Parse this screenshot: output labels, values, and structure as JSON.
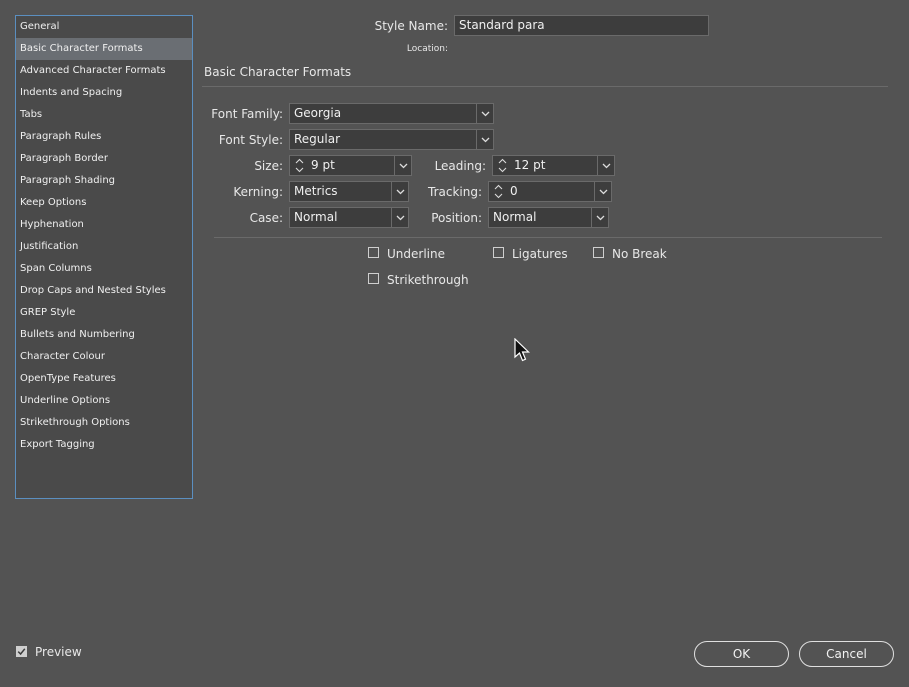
{
  "sidebar": {
    "items": [
      {
        "label": "General"
      },
      {
        "label": "Basic Character Formats"
      },
      {
        "label": "Advanced Character Formats"
      },
      {
        "label": "Indents and Spacing"
      },
      {
        "label": "Tabs"
      },
      {
        "label": "Paragraph Rules"
      },
      {
        "label": "Paragraph Border"
      },
      {
        "label": "Paragraph Shading"
      },
      {
        "label": "Keep Options"
      },
      {
        "label": "Hyphenation"
      },
      {
        "label": "Justification"
      },
      {
        "label": "Span Columns"
      },
      {
        "label": "Drop Caps and Nested Styles"
      },
      {
        "label": "GREP Style"
      },
      {
        "label": "Bullets and Numbering"
      },
      {
        "label": "Character Colour"
      },
      {
        "label": "OpenType Features"
      },
      {
        "label": "Underline Options"
      },
      {
        "label": "Strikethrough Options"
      },
      {
        "label": "Export Tagging"
      }
    ],
    "selected_index": 1
  },
  "header": {
    "style_name_label": "Style Name:",
    "style_name_value": "Standard para",
    "location_label": "Location:"
  },
  "section_title": "Basic Character Formats",
  "form": {
    "font_family": {
      "label": "Font Family:",
      "value": "Georgia"
    },
    "font_style": {
      "label": "Font Style:",
      "value": "Regular"
    },
    "size": {
      "label": "Size:",
      "value": "9 pt"
    },
    "leading": {
      "label": "Leading:",
      "value": "12 pt"
    },
    "kerning": {
      "label": "Kerning:",
      "value": "Metrics"
    },
    "tracking": {
      "label": "Tracking:",
      "value": "0"
    },
    "case": {
      "label": "Case:",
      "value": "Normal"
    },
    "position": {
      "label": "Position:",
      "value": "Normal"
    }
  },
  "checkboxes": {
    "underline": {
      "label": "Underline",
      "checked": false
    },
    "ligatures": {
      "label": "Ligatures",
      "checked": false
    },
    "no_break": {
      "label": "No Break",
      "checked": false
    },
    "strikethrough": {
      "label": "Strikethrough",
      "checked": false
    }
  },
  "footer": {
    "preview_label": "Preview",
    "preview_checked": true,
    "ok_label": "OK",
    "cancel_label": "Cancel"
  },
  "colors": {
    "background": "#535353",
    "sidebar_border": "#5b8fc0",
    "selected_item": "#6a6e73"
  }
}
